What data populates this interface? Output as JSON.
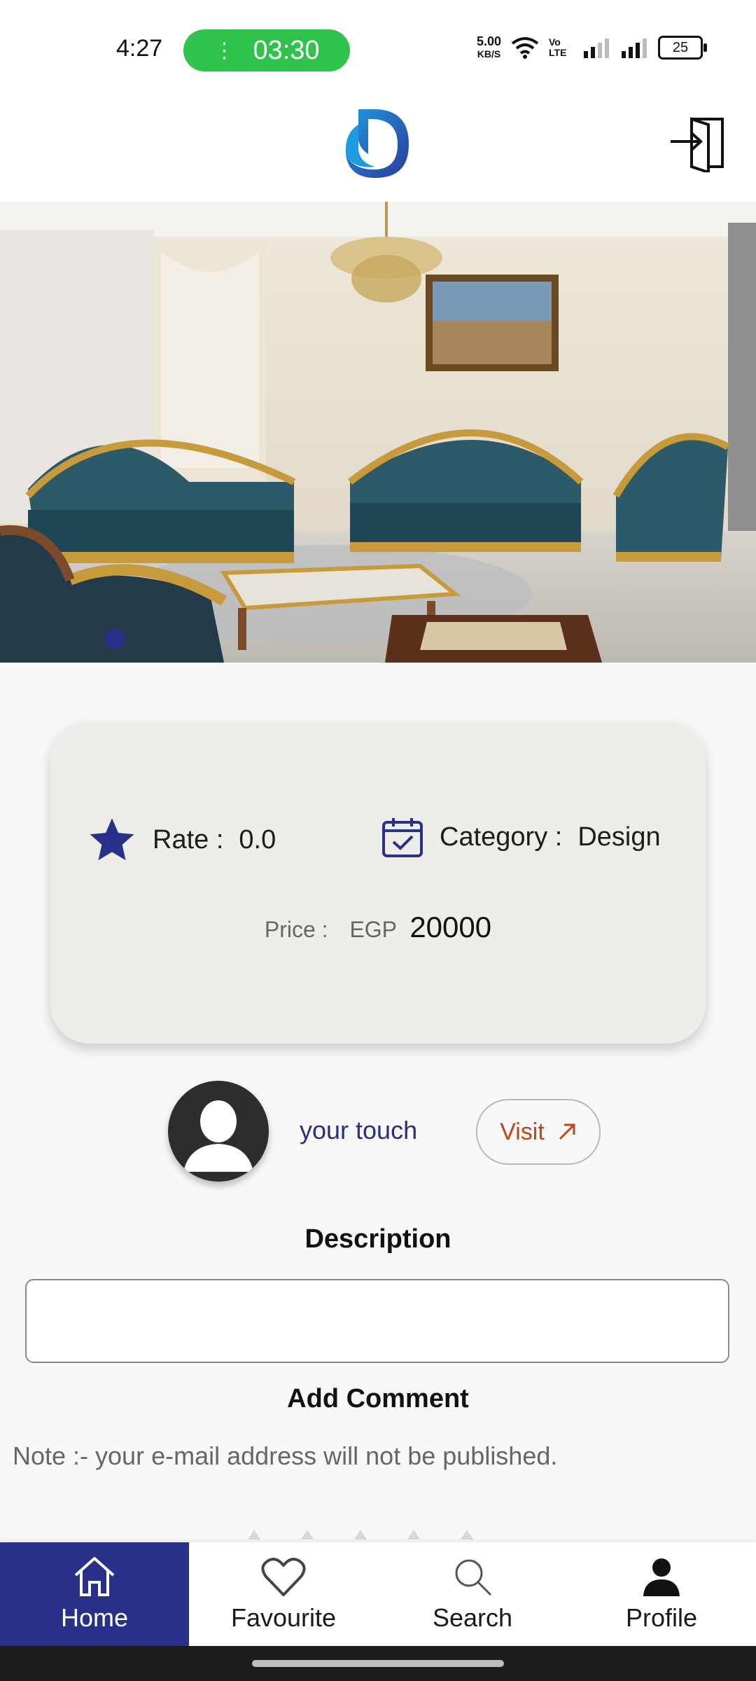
{
  "status_bar": {
    "time": "4:27",
    "call_timer": "03:30",
    "net_speed": "5.00",
    "net_speed_unit": "KB/S",
    "volte": "Vo LTE",
    "battery": "25"
  },
  "header": {
    "logo_icon": "d-letter-logo",
    "logout_icon": "logout-door-icon"
  },
  "hero": {
    "image_description_icon": "furniture-living-room-photo",
    "pager_active_index": 0
  },
  "info": {
    "rate_label": "Rate :",
    "rate_value": "0.0",
    "category_label": "Category :",
    "category_value": "Design",
    "price_label": "Price :",
    "price_currency": "EGP",
    "price_value": "20000"
  },
  "owner": {
    "name": "your touch",
    "visit_label": "Visit"
  },
  "description": {
    "title": "Description",
    "text": ""
  },
  "comment": {
    "title": "Add Comment",
    "note": "Note :- your e-mail address will not be published."
  },
  "bottom_nav": {
    "items": [
      {
        "label": "Home",
        "icon": "home-icon",
        "active": true
      },
      {
        "label": "Favourite",
        "icon": "heart-icon",
        "active": false
      },
      {
        "label": "Search",
        "icon": "search-icon",
        "active": false
      },
      {
        "label": "Profile",
        "icon": "person-icon",
        "active": false
      }
    ]
  },
  "colors": {
    "primary": "#28308a",
    "call_green": "#2fc34e",
    "visit_accent": "#c0441c",
    "card_bg": "#eeedea"
  }
}
